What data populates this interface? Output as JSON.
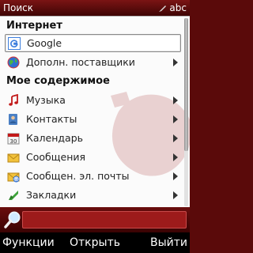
{
  "titlebar": {
    "title": "Поиск",
    "input_indicator": "abc"
  },
  "sections": [
    {
      "title": "Интернет"
    },
    {
      "title": "Мое содержимое"
    }
  ],
  "internet_items": [
    {
      "label": "Google",
      "icon": "google-icon",
      "selected": true,
      "has_submenu": false
    },
    {
      "label": "Дополн. поставщики",
      "icon": "globe-icon",
      "selected": false,
      "has_submenu": true
    }
  ],
  "content_items": [
    {
      "label": "Музыка",
      "icon": "music-note-icon",
      "has_submenu": true
    },
    {
      "label": "Контакты",
      "icon": "contacts-icon",
      "has_submenu": true
    },
    {
      "label": "Календарь",
      "icon": "calendar-icon",
      "has_submenu": true
    },
    {
      "label": "Сообщения",
      "icon": "envelope-icon",
      "has_submenu": true
    },
    {
      "label": "Сообщен. эл. почты",
      "icon": "email-icon",
      "has_submenu": true
    },
    {
      "label": "Закладки",
      "icon": "bookmark-icon",
      "has_submenu": true
    }
  ],
  "search": {
    "value": "",
    "icon": "magnifier-icon"
  },
  "softkeys": {
    "left": "Функции",
    "middle": "Открыть",
    "right": "Выйти"
  },
  "colors": {
    "theme_red": "#5a0a0a",
    "field_red": "#9d1b1b",
    "list_bg": "#fbfbfb"
  }
}
